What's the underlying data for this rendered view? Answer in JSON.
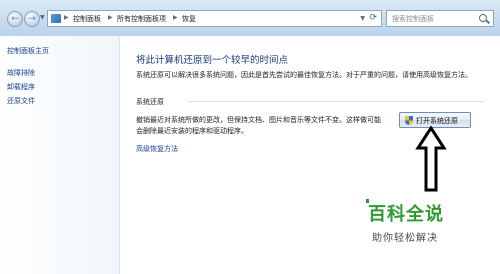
{
  "address_bar": {
    "breadcrumbs": [
      "控制面板",
      "所有控制面板项",
      "恢复"
    ]
  },
  "search": {
    "placeholder": "搜索控制面板"
  },
  "sidebar": {
    "items": [
      {
        "label": "控制面板主页"
      },
      {
        "label": "故障排除"
      },
      {
        "label": "卸载程序"
      },
      {
        "label": "还原文件"
      }
    ]
  },
  "main": {
    "title": "将此计算机还原到一个较早的时间点",
    "description": "系统还原可以解决很多系统问题，因此是首先尝试的最佳恢复方法。对于严重的问题，请使用高级恢复方法。",
    "section_label": "系统还原",
    "restore_desc_line1": "撤销最近对系统所做的更改，但保持文档、图片和音乐等文件不变。这样做可能",
    "restore_desc_line2": "会删除最近安装的程序和驱动程序。",
    "open_button_label": "打开系统还原",
    "advanced_link": "高级恢复方法"
  },
  "watermark": {
    "brand": "百科全说",
    "slogan": "助你轻松解决"
  },
  "colors": {
    "link": "#1b3d8f",
    "title": "#1d3b7c",
    "brand_green": "#2f9a2f"
  }
}
